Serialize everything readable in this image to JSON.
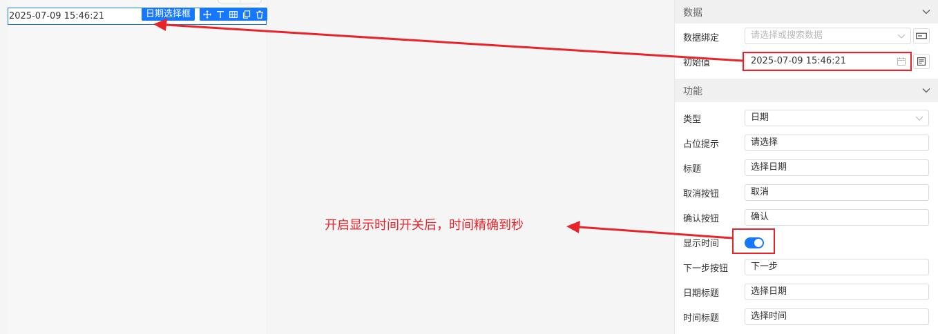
{
  "canvas": {
    "widget_value": "2025-07-09 15:46:21",
    "widget_label": "日期选择框",
    "toolbar_icons": [
      "move-icon",
      "align-top-icon",
      "table-icon",
      "copy-icon",
      "delete-icon"
    ]
  },
  "panel": {
    "data_section": {
      "title": "数据",
      "binding_label": "数据绑定",
      "binding_placeholder": "请选择或搜索数据",
      "initial_label": "初始值",
      "initial_value": "2025-07-09 15:46:21"
    },
    "func_section": {
      "title": "功能",
      "type_label": "类型",
      "type_value": "日期",
      "placeholder_label": "占位提示",
      "placeholder_value": "请选择",
      "title_label": "标题",
      "title_value": "选择日期",
      "cancel_label": "取消按钮",
      "cancel_value": "取消",
      "confirm_label": "确认按钮",
      "confirm_value": "确认",
      "show_time_label": "显示时间",
      "show_time_on": true,
      "next_label": "下一步按钮",
      "next_value": "下一步",
      "date_title_label": "日期标题",
      "date_title_value": "选择日期",
      "time_title_label": "时间标题",
      "time_title_value": "选择时间"
    }
  },
  "annotation": {
    "text": "开启显示时间开关后，时间精确到秒",
    "color": "#e8232a"
  },
  "colors": {
    "accent": "#1677ff",
    "annotation": "#e8232a"
  }
}
